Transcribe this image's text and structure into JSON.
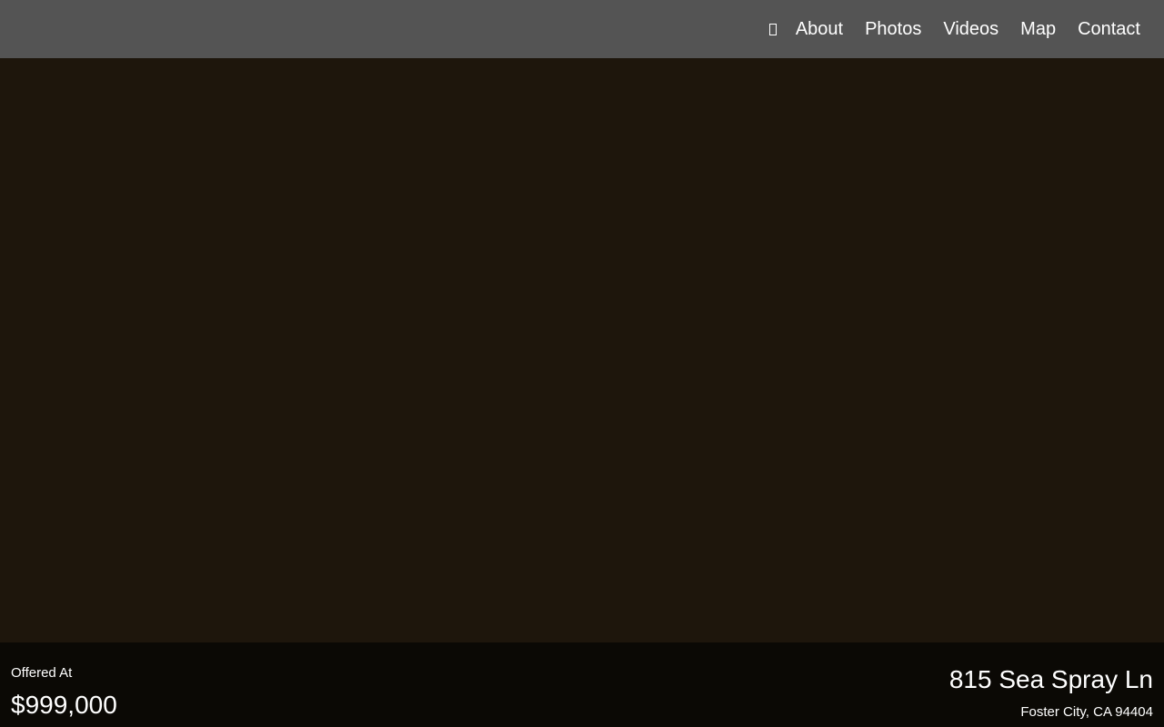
{
  "nav": {
    "icon": "box-icon",
    "links": [
      "About",
      "Photos",
      "Videos",
      "Map",
      "Contact"
    ]
  },
  "colors": {
    "topbar": "#545454",
    "hero": "#1e160c",
    "footer": "#0b0905",
    "text": "#ffffff"
  },
  "listing": {
    "offered_label": "Offered At",
    "price": "$999,000",
    "address": "815 Sea Spray Ln",
    "city_state_zip": "Foster City, CA 94404"
  }
}
